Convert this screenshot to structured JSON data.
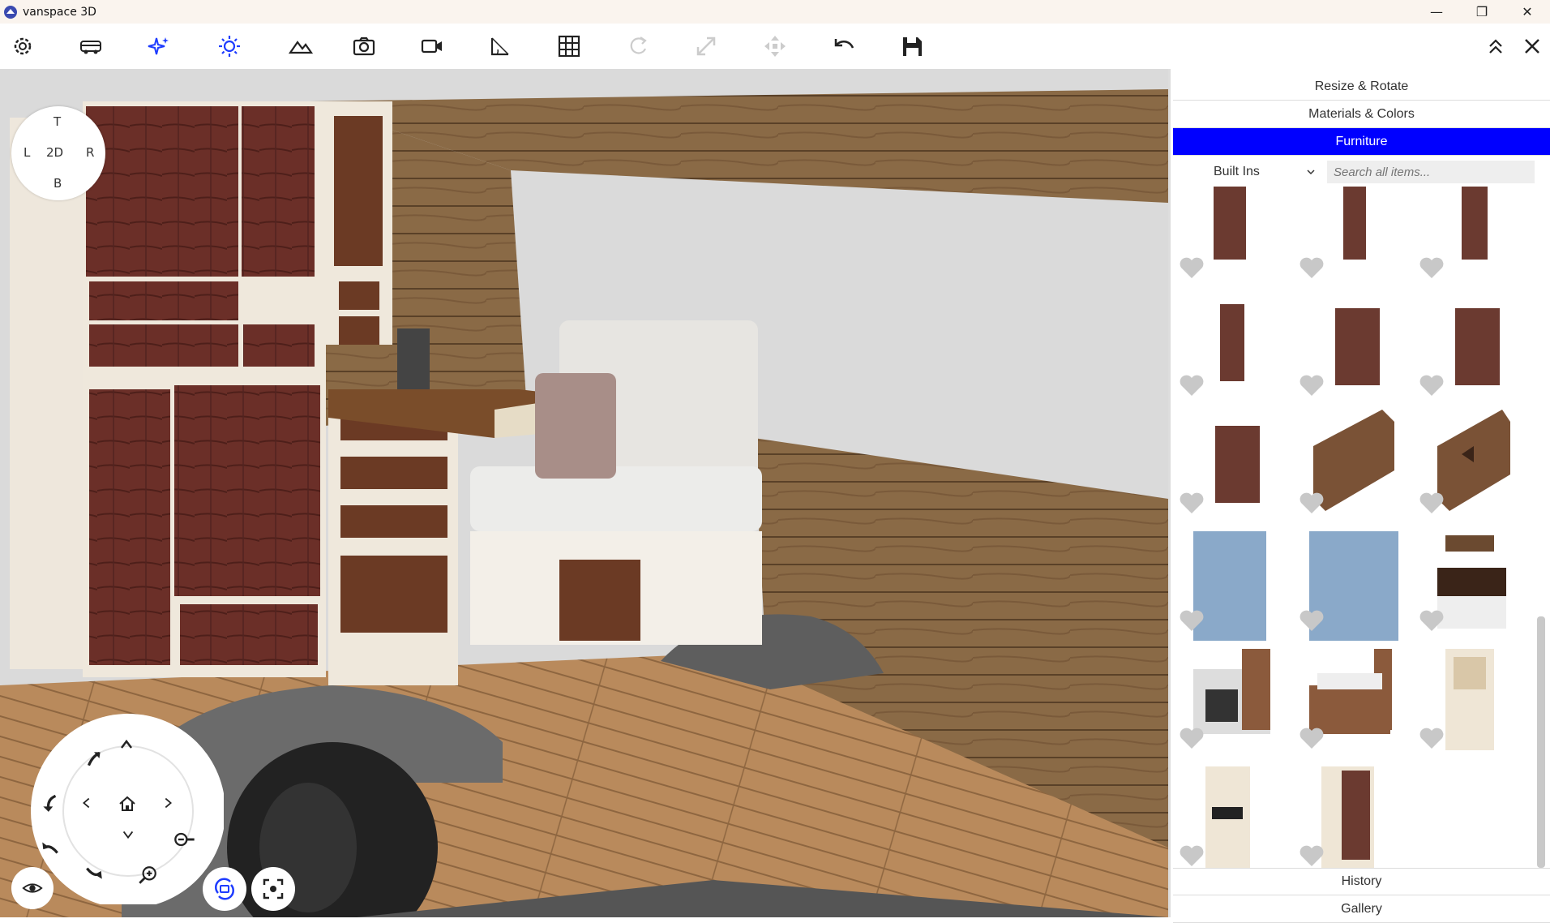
{
  "window": {
    "title": "vanspace 3D",
    "minimize": "—",
    "maximize": "❐",
    "close": "✕"
  },
  "toolbar": {
    "items": [
      "settings-icon",
      "van-icon",
      "sparkle-icon",
      "sun-icon",
      "terrain-icon",
      "camera-icon",
      "video-icon",
      "measure-icon",
      "grid-icon",
      "rotate-icon",
      "resize-icon",
      "move-icon",
      "undo-icon",
      "save-icon"
    ],
    "collapse": "⌃⌃",
    "close": "✕"
  },
  "view_cube": {
    "top": "T",
    "left": "L",
    "center": "2D",
    "right": "R",
    "bottom": "B"
  },
  "panel": {
    "sections": {
      "resize_rotate": "Resize & Rotate",
      "materials_colors": "Materials & Colors",
      "furniture": "Furniture",
      "history": "History",
      "gallery": "Gallery"
    },
    "category": "Built Ins",
    "search_placeholder": "Search all items...",
    "accent": "#0000ff"
  }
}
